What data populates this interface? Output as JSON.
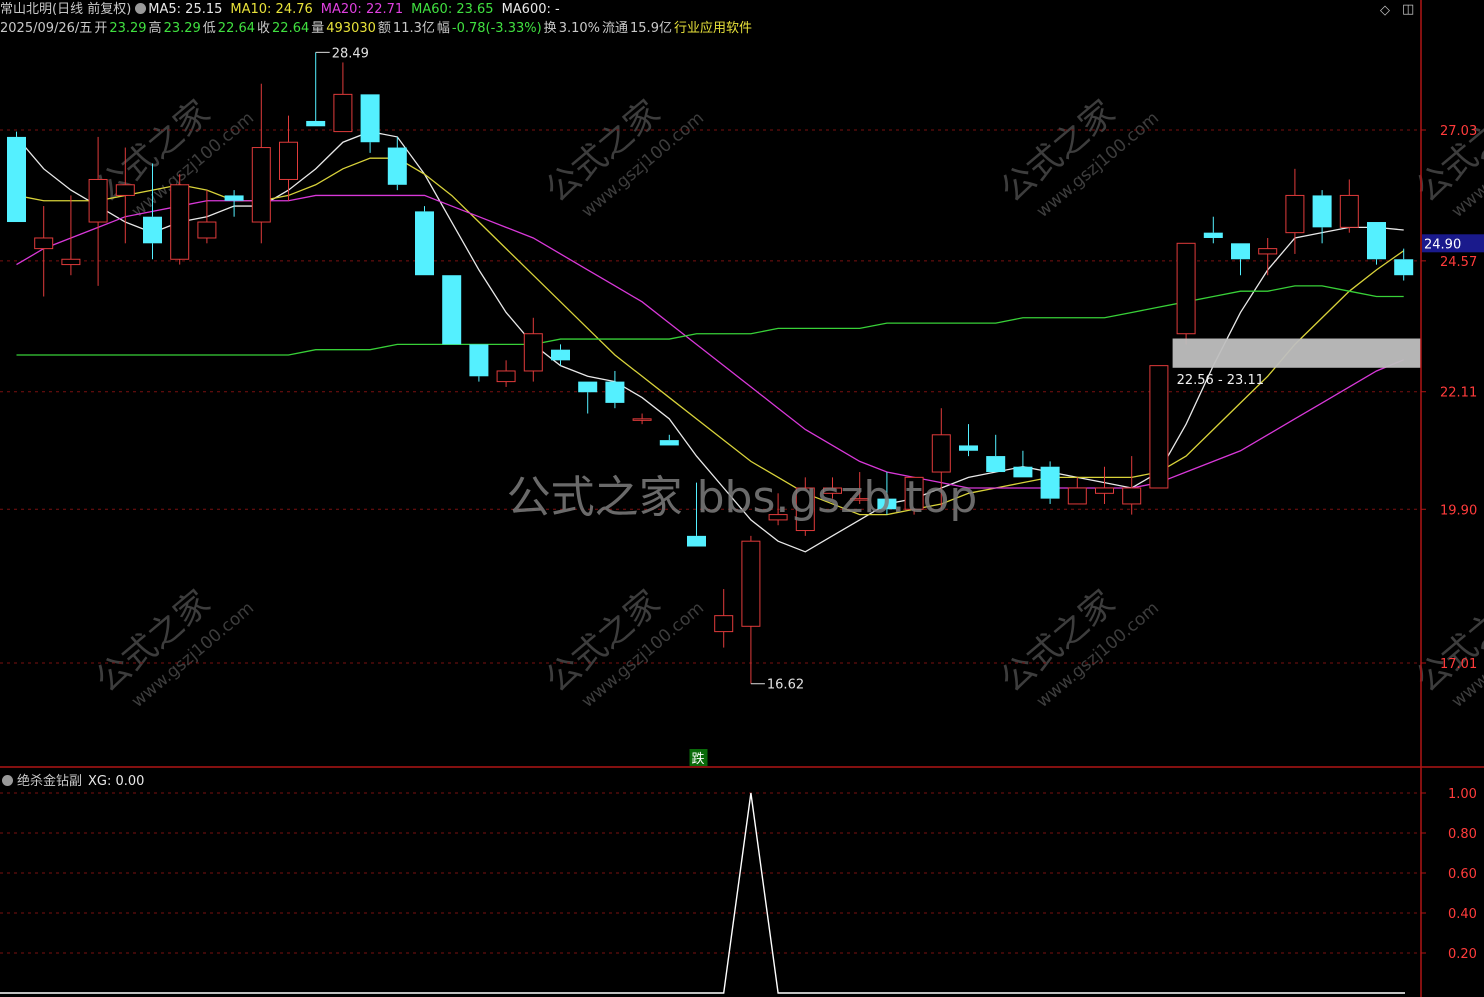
{
  "header": {
    "stock_title": "常山北明(日线 前复权)",
    "ma5": "MA5: 25.15",
    "ma10": "MA10: 24.76",
    "ma20": "MA20: 22.71",
    "ma60": "MA60: 23.65",
    "ma600": "MA600: -",
    "date": "2025/09/26/五",
    "open_label": "开",
    "open": "23.29",
    "high_label": "高",
    "high": "23.29",
    "low_label": "低",
    "low": "22.64",
    "close_label": "收",
    "close": "22.64",
    "volume_label": "量",
    "volume": "493030",
    "amount_label": "额",
    "amount": "11.3亿",
    "change_label": "幅",
    "change": "-0.78(-3.33%)",
    "turnover_label": "换",
    "turnover": "3.10%",
    "float_label": "流通",
    "float": "15.9亿",
    "sector": "行业应用软件"
  },
  "indicator": {
    "name": "绝杀金钻副",
    "xg": "XG: 0.00"
  },
  "annotations": {
    "high_mark": "28.49",
    "low_mark": "16.62",
    "drop_badge": "跌",
    "range_box": "22.56 - 23.11",
    "current_price": "24.90"
  },
  "watermark": {
    "center": "公式之家 bbs.gszb.top",
    "tile_main": "公式之家",
    "tile_url": "www.gszj100.com"
  },
  "colors": {
    "background": "#000000",
    "grid": "#7a1010",
    "axis": "#b01515",
    "up": "#e03b3b",
    "down": "#54f0ff",
    "ma5": "#e8e8e8",
    "ma10": "#d8d23a",
    "ma20": "#d838d8",
    "ma60": "#38d038",
    "price_label": "#ff3b3b",
    "current_price_bg": "#1a1a8c",
    "range_box": "#bfbfbf"
  },
  "chart_data": [
    {
      "type": "candlestick",
      "title": "常山北明(日线 前复权)",
      "y_ticks": [
        27.03,
        24.57,
        22.11,
        19.9,
        17.01
      ],
      "y_tick_labels": [
        "27.03",
        "24.57",
        "22.11",
        "19.90",
        "17.01"
      ],
      "ylim": [
        15.8,
        29.3
      ],
      "grid": true,
      "ohlc": [
        [
          26.9,
          27.0,
          25.3,
          25.3
        ],
        [
          24.8,
          25.6,
          23.9,
          25.0
        ],
        [
          24.5,
          25.8,
          24.3,
          24.6
        ],
        [
          25.3,
          26.9,
          24.1,
          26.1
        ],
        [
          25.8,
          26.7,
          24.9,
          26.0
        ],
        [
          25.4,
          26.4,
          24.6,
          24.9
        ],
        [
          24.6,
          26.2,
          24.5,
          26.0
        ],
        [
          25.0,
          25.9,
          24.9,
          25.3
        ],
        [
          25.8,
          25.9,
          25.4,
          25.7
        ],
        [
          25.3,
          27.9,
          24.9,
          26.7
        ],
        [
          26.1,
          27.3,
          25.7,
          26.8
        ],
        [
          27.2,
          28.49,
          27.1,
          27.1
        ],
        [
          27.0,
          28.3,
          27.0,
          27.7
        ],
        [
          27.7,
          27.7,
          26.6,
          26.8
        ],
        [
          26.7,
          26.9,
          25.9,
          26.0
        ],
        [
          25.5,
          25.6,
          24.3,
          24.3
        ],
        [
          24.3,
          24.3,
          23.0,
          23.0
        ],
        [
          23.0,
          23.0,
          22.3,
          22.4
        ],
        [
          22.3,
          22.7,
          22.2,
          22.5
        ],
        [
          22.5,
          23.5,
          22.3,
          23.2
        ],
        [
          22.9,
          23.0,
          22.6,
          22.7
        ],
        [
          22.3,
          22.3,
          21.7,
          22.1
        ],
        [
          22.3,
          22.5,
          21.8,
          21.9
        ],
        [
          21.6,
          21.7,
          21.5,
          21.6
        ],
        [
          21.2,
          21.3,
          21.1,
          21.1
        ],
        [
          19.4,
          20.4,
          19.3,
          19.2
        ],
        [
          17.6,
          18.4,
          17.3,
          17.9
        ],
        [
          17.7,
          19.4,
          16.62,
          19.3
        ],
        [
          19.7,
          20.2,
          19.6,
          19.8
        ],
        [
          19.5,
          20.5,
          19.4,
          20.3
        ],
        [
          20.2,
          20.5,
          20.1,
          20.3
        ],
        [
          20.1,
          20.6,
          20.0,
          20.1
        ],
        [
          20.1,
          20.6,
          19.8,
          19.9
        ],
        [
          19.9,
          20.5,
          19.8,
          20.5
        ],
        [
          20.6,
          21.8,
          19.9,
          21.3
        ],
        [
          21.1,
          21.5,
          20.9,
          21.0
        ],
        [
          20.9,
          21.3,
          20.6,
          20.6
        ],
        [
          20.7,
          21.0,
          20.5,
          20.5
        ],
        [
          20.7,
          20.8,
          20.0,
          20.1
        ],
        [
          20.0,
          20.5,
          20.0,
          20.3
        ],
        [
          20.2,
          20.7,
          20.0,
          20.3
        ],
        [
          20.0,
          20.9,
          19.8,
          20.3
        ],
        [
          20.3,
          22.6,
          20.3,
          22.6
        ],
        [
          23.2,
          24.9,
          23.0,
          24.9
        ],
        [
          25.1,
          25.4,
          24.9,
          25.0
        ],
        [
          24.9,
          24.9,
          24.3,
          24.6
        ],
        [
          24.7,
          25.0,
          24.3,
          24.8
        ],
        [
          25.1,
          26.3,
          24.7,
          25.8
        ],
        [
          25.8,
          25.9,
          24.9,
          25.2
        ],
        [
          25.2,
          26.1,
          25.1,
          25.8
        ],
        [
          25.3,
          25.3,
          24.5,
          24.6
        ],
        [
          24.6,
          24.8,
          24.2,
          24.3
        ]
      ],
      "series": [
        {
          "name": "MA5",
          "values": [
            26.9,
            26.3,
            25.9,
            25.6,
            25.3,
            25.1,
            25.3,
            25.4,
            25.6,
            25.6,
            25.9,
            26.3,
            26.8,
            27.0,
            26.9,
            26.2,
            25.3,
            24.4,
            23.6,
            23.0,
            22.6,
            22.4,
            22.3,
            22.0,
            21.6,
            20.9,
            20.3,
            19.7,
            19.3,
            19.1,
            19.4,
            19.7,
            20.0,
            20.1,
            20.3,
            20.5,
            20.6,
            20.7,
            20.6,
            20.5,
            20.4,
            20.3,
            20.6,
            21.5,
            22.6,
            23.6,
            24.4,
            25.0,
            25.1,
            25.2,
            25.2,
            25.15
          ]
        },
        {
          "name": "MA10",
          "values": [
            25.8,
            25.7,
            25.7,
            25.7,
            25.8,
            25.9,
            26.0,
            25.9,
            25.7,
            25.7,
            25.8,
            26.0,
            26.3,
            26.5,
            26.5,
            26.2,
            25.8,
            25.3,
            24.8,
            24.3,
            23.8,
            23.3,
            22.8,
            22.4,
            22.0,
            21.6,
            21.2,
            20.8,
            20.5,
            20.2,
            20.0,
            19.8,
            19.8,
            19.9,
            20.0,
            20.2,
            20.3,
            20.4,
            20.5,
            20.5,
            20.5,
            20.5,
            20.6,
            20.9,
            21.4,
            21.9,
            22.4,
            23.0,
            23.5,
            24.0,
            24.4,
            24.76
          ]
        },
        {
          "name": "MA20",
          "values": [
            24.5,
            24.8,
            25.0,
            25.2,
            25.4,
            25.5,
            25.6,
            25.7,
            25.7,
            25.7,
            25.7,
            25.8,
            25.8,
            25.8,
            25.8,
            25.8,
            25.6,
            25.4,
            25.2,
            25.0,
            24.7,
            24.4,
            24.1,
            23.8,
            23.4,
            23.0,
            22.6,
            22.2,
            21.8,
            21.4,
            21.1,
            20.8,
            20.6,
            20.5,
            20.4,
            20.3,
            20.3,
            20.3,
            20.3,
            20.3,
            20.3,
            20.3,
            20.4,
            20.6,
            20.8,
            21.0,
            21.3,
            21.6,
            21.9,
            22.2,
            22.5,
            22.71
          ]
        },
        {
          "name": "MA60",
          "values": [
            22.8,
            22.8,
            22.8,
            22.8,
            22.8,
            22.8,
            22.8,
            22.8,
            22.8,
            22.8,
            22.8,
            22.9,
            22.9,
            22.9,
            23.0,
            23.0,
            23.0,
            23.0,
            23.0,
            23.0,
            23.1,
            23.1,
            23.1,
            23.1,
            23.1,
            23.2,
            23.2,
            23.2,
            23.3,
            23.3,
            23.3,
            23.3,
            23.4,
            23.4,
            23.4,
            23.4,
            23.4,
            23.5,
            23.5,
            23.5,
            23.5,
            23.6,
            23.7,
            23.8,
            23.9,
            24.0,
            24.0,
            24.1,
            24.1,
            24.0,
            23.9,
            23.9
          ]
        }
      ],
      "high_mark": 28.49,
      "low_mark": 16.62,
      "range_box": [
        22.56,
        23.11
      ],
      "current_price": 24.9
    },
    {
      "type": "line",
      "title": "绝杀金钻副",
      "series": [
        {
          "name": "XG",
          "values": [
            0,
            0,
            0,
            0,
            0,
            0,
            0,
            0,
            0,
            0,
            0,
            0,
            0,
            0,
            0,
            0,
            0,
            0,
            0,
            0,
            0,
            0,
            0,
            0,
            0,
            0,
            0,
            1,
            0,
            0,
            0,
            0,
            0,
            0,
            0,
            0,
            0,
            0,
            0,
            0,
            0,
            0,
            0,
            0,
            0,
            0,
            0,
            0,
            0,
            0,
            0,
            0
          ]
        }
      ],
      "y_ticks": [
        1.0,
        0.8,
        0.6,
        0.4,
        0.2
      ],
      "y_tick_labels": [
        "1.00",
        "0.80",
        "0.60",
        "0.40",
        "0.20"
      ],
      "ylim": [
        0,
        1.08
      ]
    }
  ]
}
